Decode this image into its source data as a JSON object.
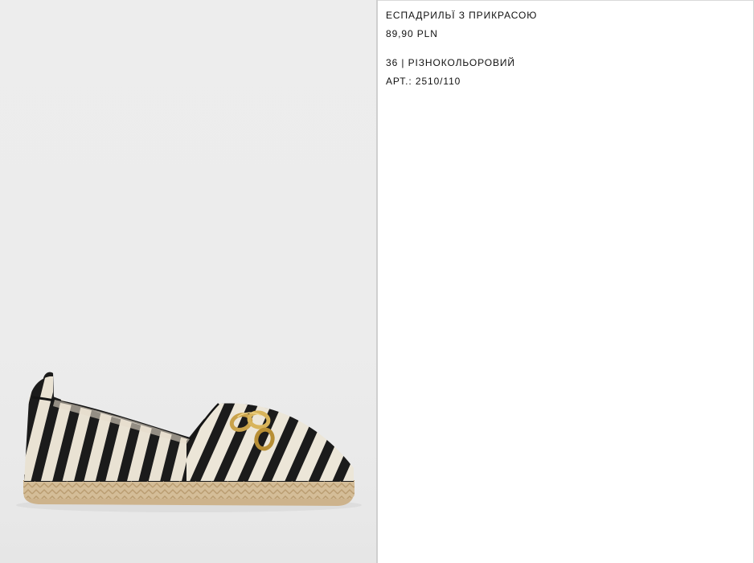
{
  "product": {
    "name": "ЕСПАДРИЛЬЇ З ПРИКРАСОЮ",
    "price": "89,90 PLN",
    "variant": "36 | РІЗНОКОЛЬОРОВИЙ",
    "reference": "АРТ.: 2510/110"
  },
  "image": {
    "subject": "striped-espadrille-with-gold-chain",
    "colors": {
      "stripe_dark": "#1b1b1b",
      "stripe_light": "#e9e2d3",
      "jute": "#d2b994",
      "sole": "#cdb38c",
      "chain": "#c9a24a"
    }
  }
}
